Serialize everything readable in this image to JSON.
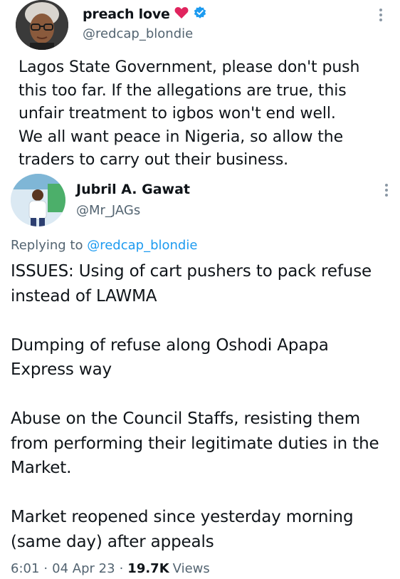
{
  "original_tweet": {
    "author": {
      "display_name": "preach love",
      "handle": "@redcap_blondie",
      "verified": true
    },
    "text_lines": [
      "Lagos State Government, please don't push",
      "this too far. If the allegations are true, this",
      "unfair treatment to igbos won't end well.",
      "We all want peace in Nigeria, so allow the",
      "traders to carry out their business."
    ]
  },
  "reply_tweet": {
    "author": {
      "display_name": "Jubril A. Gawat",
      "handle": "@Mr_JAGs"
    },
    "replying_label": "Replying to",
    "replying_to": "@redcap_blondie",
    "paragraphs": [
      "ISSUES: Using of cart pushers to pack refuse instead of LAWMA",
      "Dumping of refuse along Oshodi Apapa Express way",
      "Abuse on the Council Staffs, resisting them from performing their legitimate duties in the Market.",
      "Market reopened since yesterday morning (same day) after appeals"
    ],
    "meta": {
      "time": "6:01",
      "separator": "·",
      "date": "04 Apr 23",
      "views_count": "19.7K",
      "views_label": "Views"
    }
  },
  "colors": {
    "text_primary": "#0f1419",
    "text_secondary": "#536471",
    "link": "#1d9bf0",
    "verified_badge": "#1d9bf0",
    "heart": "#e0245e"
  },
  "icons": {
    "heart": "heart-emoji-icon",
    "verified": "verified-badge-icon",
    "more": "more-options-icon"
  }
}
